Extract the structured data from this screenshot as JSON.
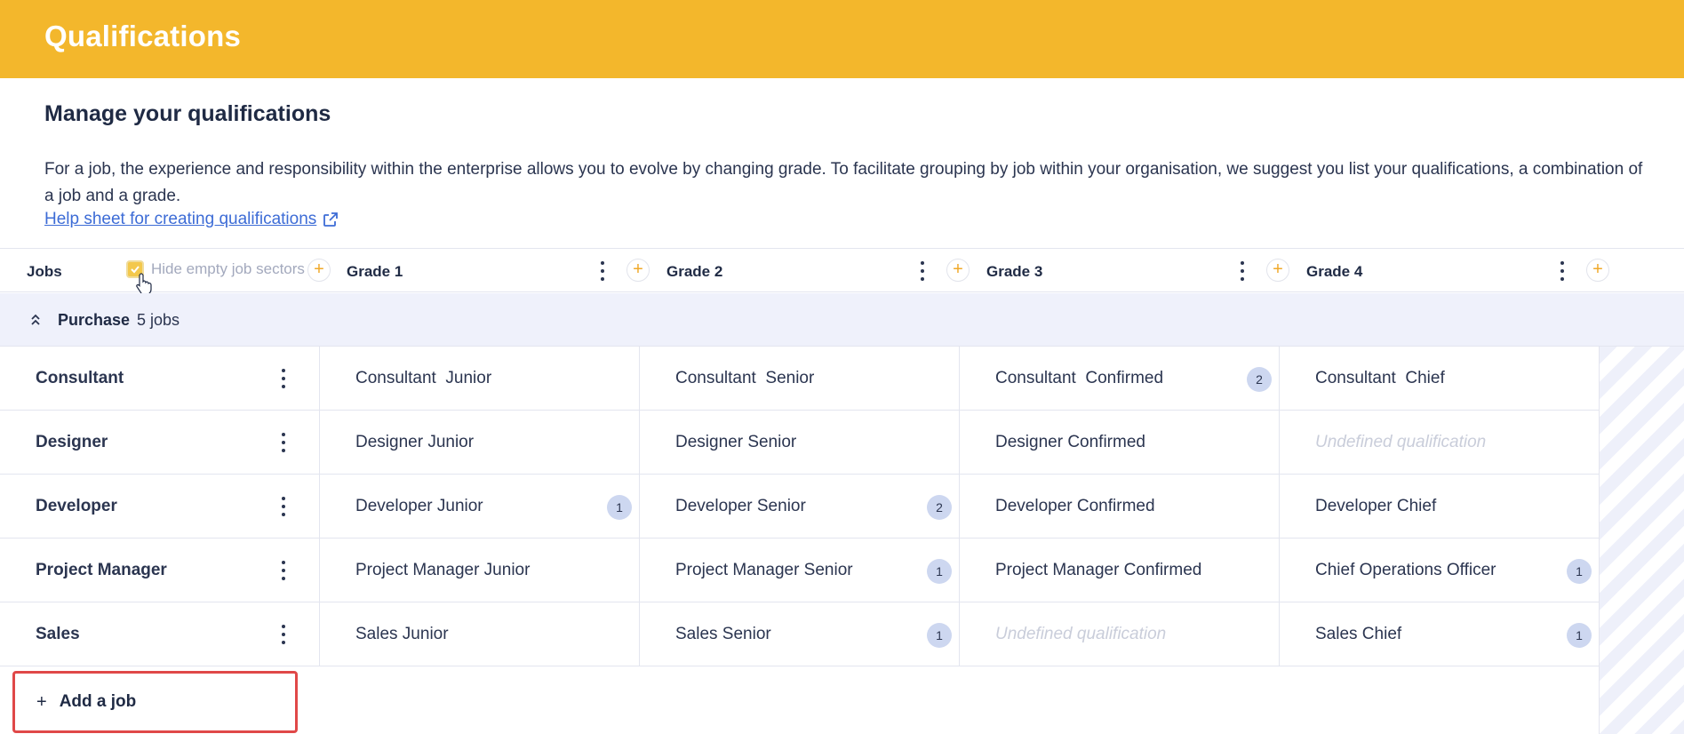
{
  "header": {
    "title": "Qualifications"
  },
  "intro": {
    "heading": "Manage your qualifications",
    "description": "For a job, the experience and responsibility within the enterprise allows you to evolve by changing grade. To facilitate grouping by job within your organisation, we suggest you list your qualifications, a combination of a job and a grade.",
    "help_link": "Help sheet for creating qualifications"
  },
  "table_header": {
    "jobs_label": "Jobs",
    "hide_empty_label": "Hide empty job sectors",
    "hide_empty_checked": true,
    "grades": [
      "Grade 1",
      "Grade 2",
      "Grade 3",
      "Grade 4"
    ]
  },
  "sector": {
    "name": "Purchase",
    "count": "5 jobs"
  },
  "jobs": [
    {
      "name": "Consultant",
      "cells": [
        {
          "text": "Consultant  Junior",
          "badge": null
        },
        {
          "text": "Consultant  Senior",
          "badge": null
        },
        {
          "text": "Consultant  Confirmed",
          "badge": "2"
        },
        {
          "text": "Consultant  Chief",
          "badge": null
        }
      ]
    },
    {
      "name": "Designer",
      "cells": [
        {
          "text": "Designer Junior",
          "badge": null
        },
        {
          "text": "Designer Senior",
          "badge": null
        },
        {
          "text": "Designer Confirmed",
          "badge": null
        },
        {
          "text": "Undefined qualification",
          "badge": null,
          "undefined": true
        }
      ]
    },
    {
      "name": "Developer",
      "cells": [
        {
          "text": "Developer Junior",
          "badge": "1"
        },
        {
          "text": "Developer Senior",
          "badge": "2"
        },
        {
          "text": "Developer Confirmed",
          "badge": null
        },
        {
          "text": "Developer Chief",
          "badge": null
        }
      ]
    },
    {
      "name": "Project Manager",
      "cells": [
        {
          "text": "Project Manager Junior",
          "badge": null
        },
        {
          "text": "Project Manager Senior",
          "badge": "1"
        },
        {
          "text": "Project Manager Confirmed",
          "badge": null
        },
        {
          "text": "Chief Operations Officer",
          "badge": "1"
        }
      ]
    },
    {
      "name": "Sales",
      "cells": [
        {
          "text": "Sales Junior",
          "badge": null
        },
        {
          "text": "Sales Senior",
          "badge": "1"
        },
        {
          "text": "Undefined qualification",
          "badge": null,
          "undefined": true
        },
        {
          "text": "Sales Chief",
          "badge": "1"
        }
      ]
    }
  ],
  "add_job": {
    "icon": "+",
    "label": "Add a job"
  },
  "colors": {
    "brand": "#f3b72c",
    "accent": "#f0a92a",
    "badge": "#cdd7f0",
    "highlight": "#e04848"
  }
}
